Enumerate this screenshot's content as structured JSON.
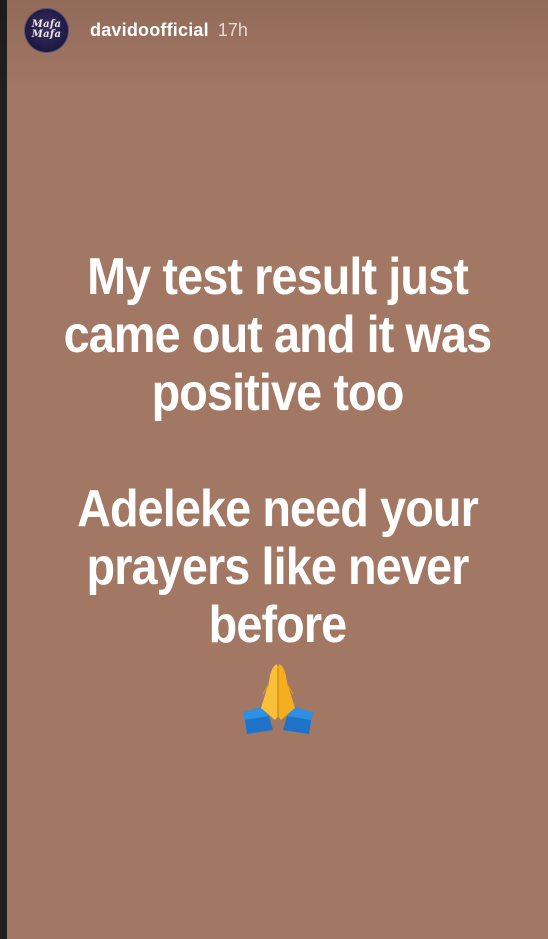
{
  "story": {
    "username": "davidoofficial",
    "time": "17h",
    "avatar_label": "Mafa Mafa",
    "background_color": "#a27763",
    "lines": [
      "My test result just came out and it was positive too",
      "Adeleke need your prayers like never before"
    ],
    "emoji_icon": "folded-hands-icon"
  }
}
